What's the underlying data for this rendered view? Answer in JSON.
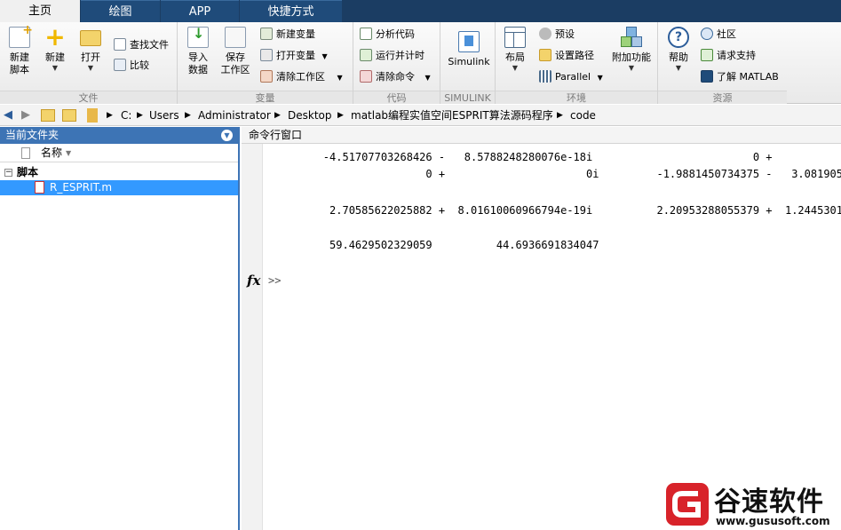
{
  "tabs": [
    {
      "label": "主页",
      "active": true
    },
    {
      "label": "绘图",
      "active": false
    },
    {
      "label": "APP",
      "active": false
    },
    {
      "label": "快捷方式",
      "active": false
    }
  ],
  "ribbon": {
    "file": {
      "title": "文件",
      "new_script": "新建\n脚本",
      "new": "新建",
      "open": "打开",
      "find_files": "查找文件",
      "compare": "比较"
    },
    "variable": {
      "title": "变量",
      "import": "导入\n数据",
      "save_ws": "保存\n工作区",
      "new_var": "新建变量",
      "open_var": "打开变量",
      "clear_ws": "清除工作区"
    },
    "code": {
      "title": "代码",
      "analyze": "分析代码",
      "run_time": "运行并计时",
      "clear_cmd": "清除命令"
    },
    "simulink": {
      "title": "SIMULINK",
      "simulink": "Simulink"
    },
    "environment": {
      "title": "环境",
      "layout": "布局",
      "preferences": "预设",
      "set_path": "设置路径",
      "parallel": "Parallel",
      "addons": "附加功能"
    },
    "resources": {
      "title": "资源",
      "help": "帮助",
      "community": "社区",
      "request_support": "请求支持",
      "learn_matlab": "了解 MATLAB"
    }
  },
  "address": {
    "crumbs": [
      "C:",
      "Users",
      "Administrator",
      "Desktop",
      "matlab编程实值空间ESPRIT算法源码程序",
      "code"
    ]
  },
  "current_folder": {
    "title": "当前文件夹",
    "column_name": "名称",
    "group": "脚本",
    "files": [
      "R_ESPRIT.m"
    ]
  },
  "command_window": {
    "title": "命令行窗口",
    "lines": [
      "        -4.51707703268426 -   8.5788248280076e-18i                         0 +",
      "                        0 +                      0i         -1.9881450734375 -   3.081905",
      "",
      "",
      "         2.70585622025882 +  8.01610060966794e-19i          2.20953288055379 +  1.2445301",
      "",
      "",
      "         59.4629502329059          44.6936691834047"
    ],
    "fx_label": "fx",
    "prompt": ">>"
  },
  "watermark": {
    "brand": "谷速软件",
    "url": "www.gususoft.com"
  },
  "colors": {
    "tab_bar": "#1b3d63",
    "panel_accent": "#3d74b5",
    "selection": "#3399ff",
    "watermark_red": "#d8232a"
  }
}
